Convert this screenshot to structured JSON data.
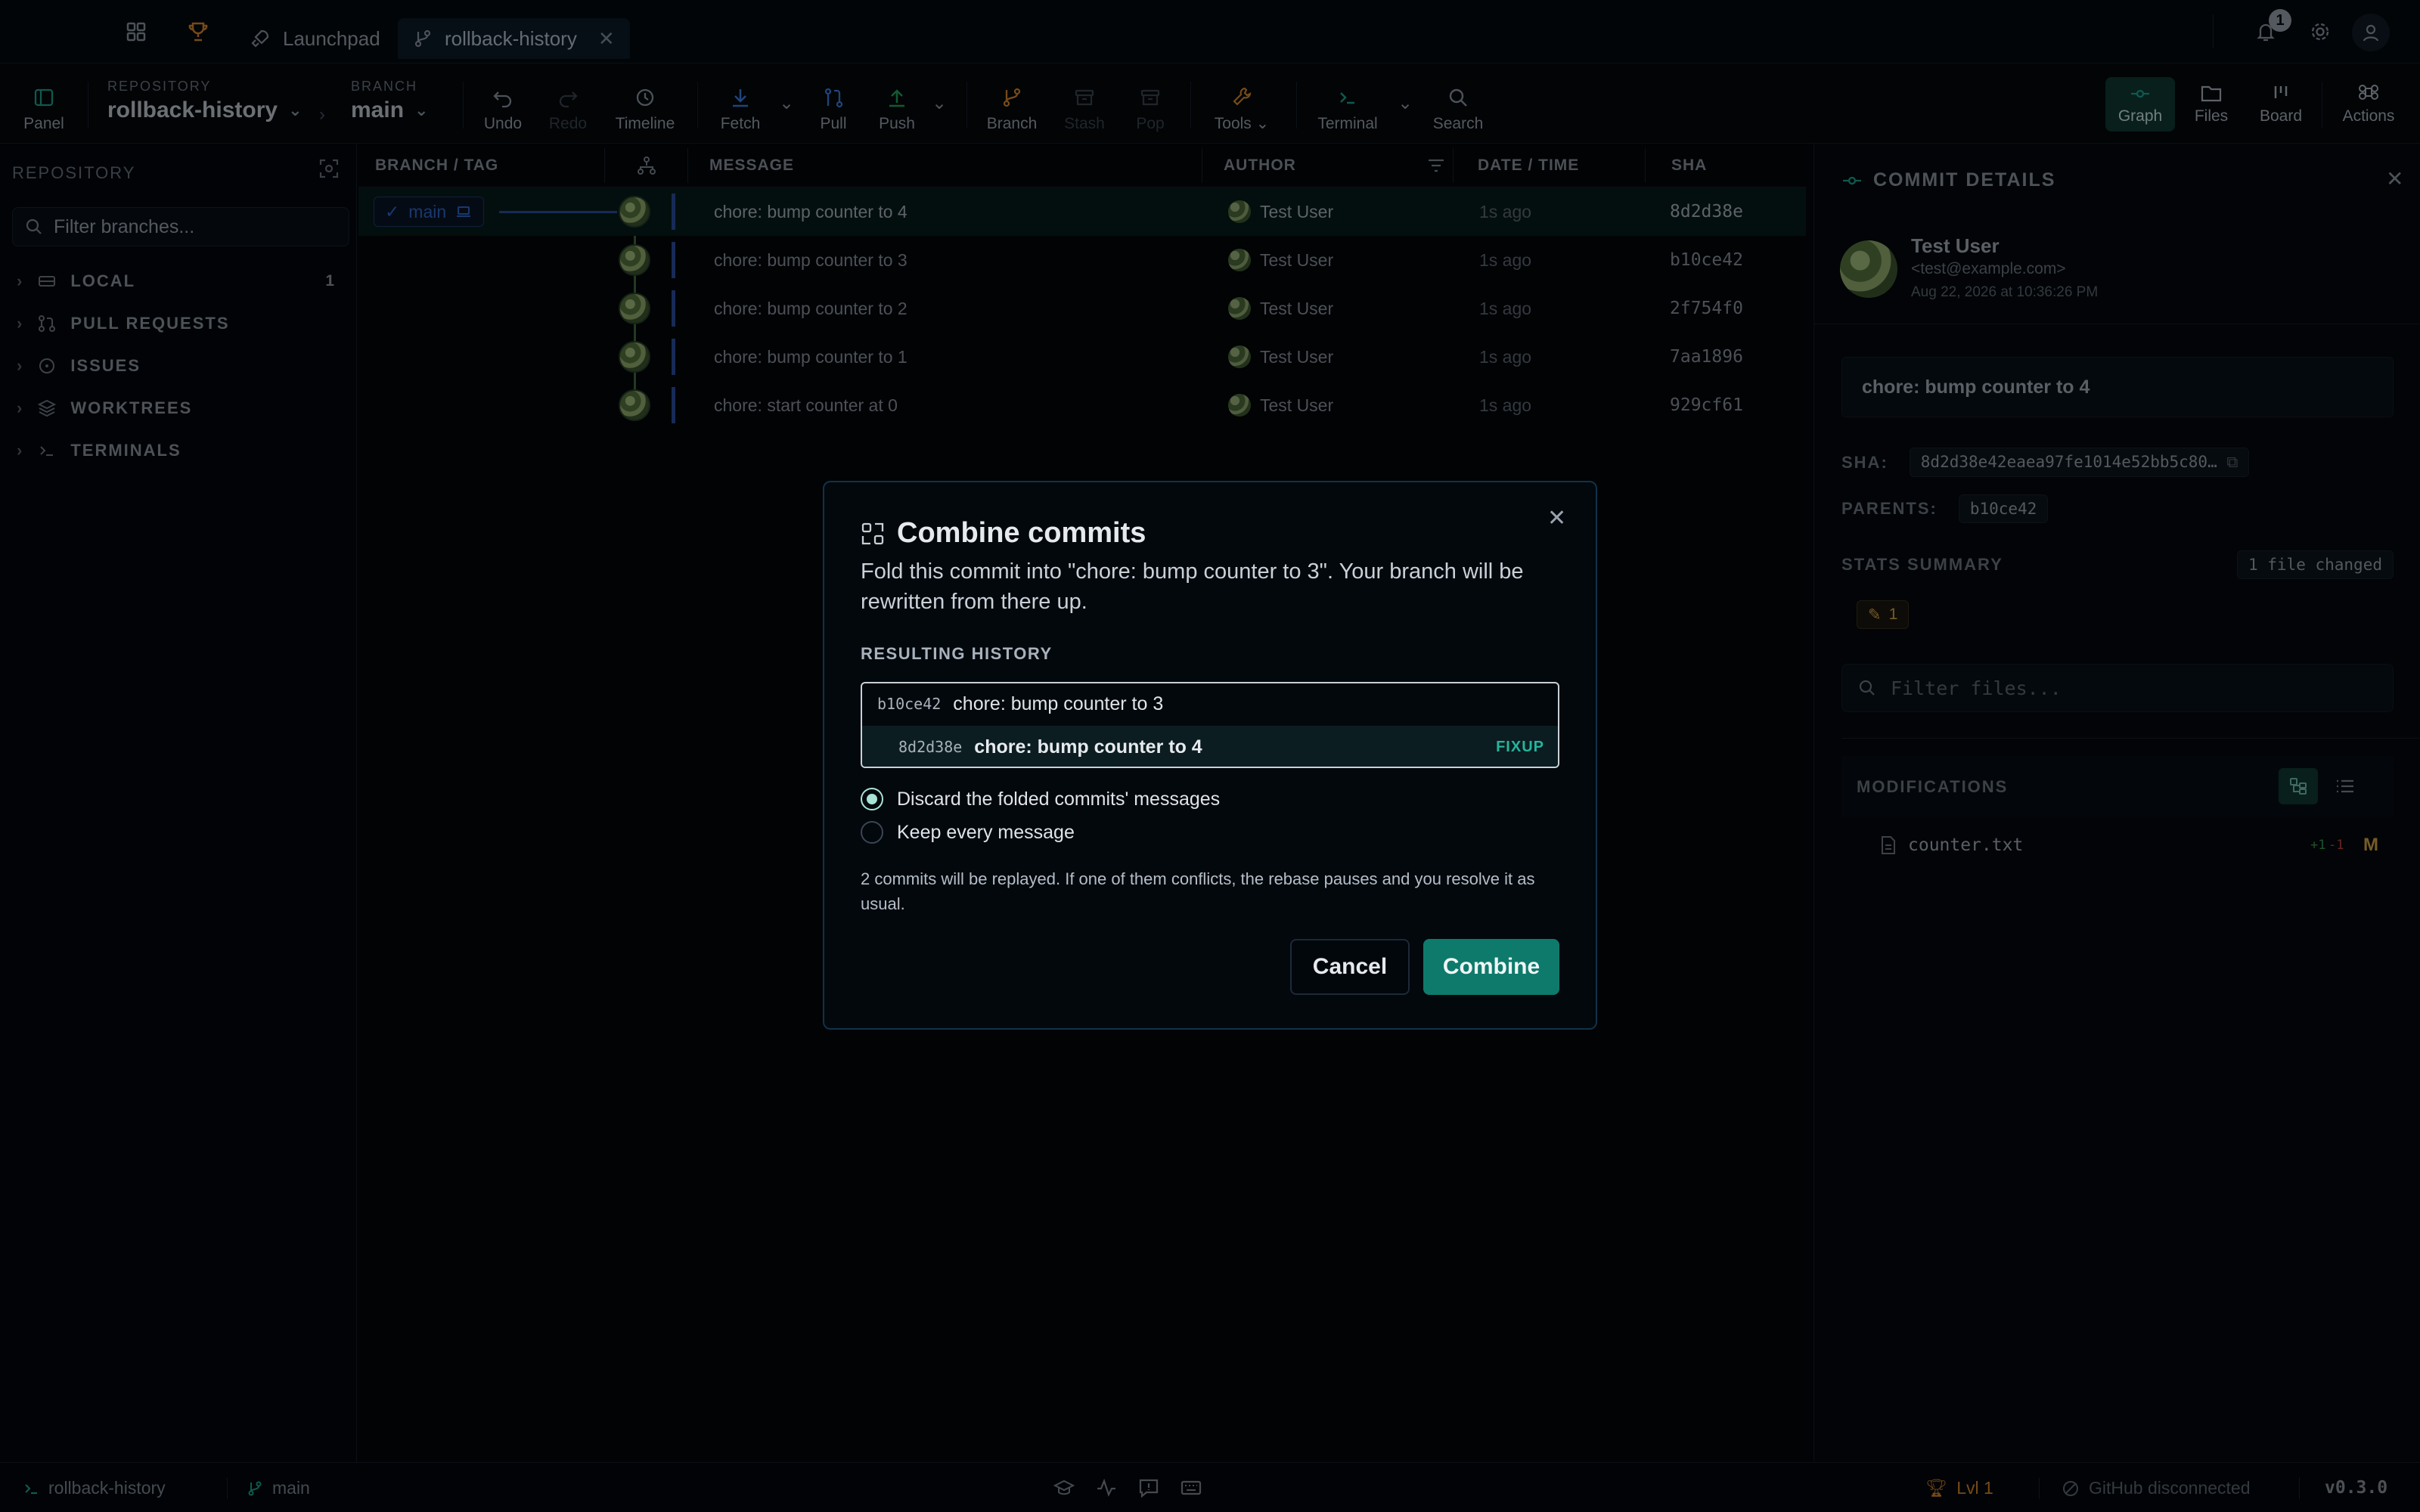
{
  "titlebar": {
    "tabs": [
      {
        "label": "Launchpad"
      },
      {
        "label": "rollback-history"
      }
    ],
    "notification_count": "1"
  },
  "toolbar": {
    "panel_label": "Panel",
    "repository_caption": "REPOSITORY",
    "repository_value": "rollback-history",
    "branch_caption": "BRANCH",
    "branch_value": "main",
    "undo": "Undo",
    "redo": "Redo",
    "timeline": "Timeline",
    "fetch": "Fetch",
    "pull": "Pull",
    "push": "Push",
    "branch": "Branch",
    "stash": "Stash",
    "pop": "Pop",
    "tools": "Tools",
    "terminal": "Terminal",
    "search": "Search",
    "views": {
      "graph": "Graph",
      "files": "Files",
      "board": "Board",
      "actions": "Actions"
    }
  },
  "sidebar": {
    "header": "REPOSITORY",
    "filter_placeholder": "Filter branches...",
    "items": [
      {
        "label": "LOCAL",
        "count": "1"
      },
      {
        "label": "PULL REQUESTS"
      },
      {
        "label": "ISSUES"
      },
      {
        "label": "WORKTREES"
      },
      {
        "label": "TERMINALS"
      }
    ]
  },
  "graph": {
    "columns": {
      "branch_tag": "BRANCH / TAG",
      "message": "MESSAGE",
      "author": "AUTHOR",
      "date_time": "DATE / TIME",
      "sha": "SHA"
    },
    "branch_label": "main",
    "commits": [
      {
        "message": "chore: bump counter to 4",
        "author": "Test User",
        "time": "1s ago",
        "sha": "8d2d38e"
      },
      {
        "message": "chore: bump counter to 3",
        "author": "Test User",
        "time": "1s ago",
        "sha": "b10ce42"
      },
      {
        "message": "chore: bump counter to 2",
        "author": "Test User",
        "time": "1s ago",
        "sha": "2f754f0"
      },
      {
        "message": "chore: bump counter to 1",
        "author": "Test User",
        "time": "1s ago",
        "sha": "7aa1896"
      },
      {
        "message": "chore: start counter at 0",
        "author": "Test User",
        "time": "1s ago",
        "sha": "929cf61"
      }
    ]
  },
  "details": {
    "title": "COMMIT DETAILS",
    "author_name": "Test User",
    "author_email": "<test@example.com>",
    "date": "Aug 22, 2026 at 10:36:26 PM",
    "message": "chore: bump counter to 4",
    "sha_label": "SHA:",
    "sha_value": "8d2d38e42eaea97fe1014e52bb5c80…",
    "parents_label": "PARENTS:",
    "parents_value": "b10ce42",
    "stats_label": "STATS SUMMARY",
    "files_changed": "1 file changed",
    "modified_count": "1",
    "filter_placeholder": "Filter files...",
    "modifications_label": "MODIFICATIONS",
    "file_name": "counter.txt",
    "file_plus": "+1",
    "file_minus": "-1",
    "file_status": "M"
  },
  "modal": {
    "title": "Combine commits",
    "description": "Fold this commit into \"chore: bump counter to 3\". Your branch will be rewritten from there up.",
    "history_label": "RESULTING HISTORY",
    "history": [
      {
        "sha": "b10ce42",
        "message": "chore: bump counter to 3"
      },
      {
        "sha": "8d2d38e",
        "message": "chore: bump counter to 4",
        "tag": "FIXUP"
      }
    ],
    "option_discard": "Discard the folded commits' messages",
    "option_keep": "Keep every message",
    "note": "2 commits will be replayed. If one of them conflicts, the rebase pauses and you resolve it as usual.",
    "cancel": "Cancel",
    "combine": "Combine"
  },
  "statusbar": {
    "repo": "rollback-history",
    "branch": "main",
    "level": "Lvl 1",
    "github": "GitHub disconnected",
    "version": "v0.3.0"
  },
  "colors": {
    "accent": "#0e7a6c",
    "background": "#03070b",
    "link": "#2f67c9"
  }
}
